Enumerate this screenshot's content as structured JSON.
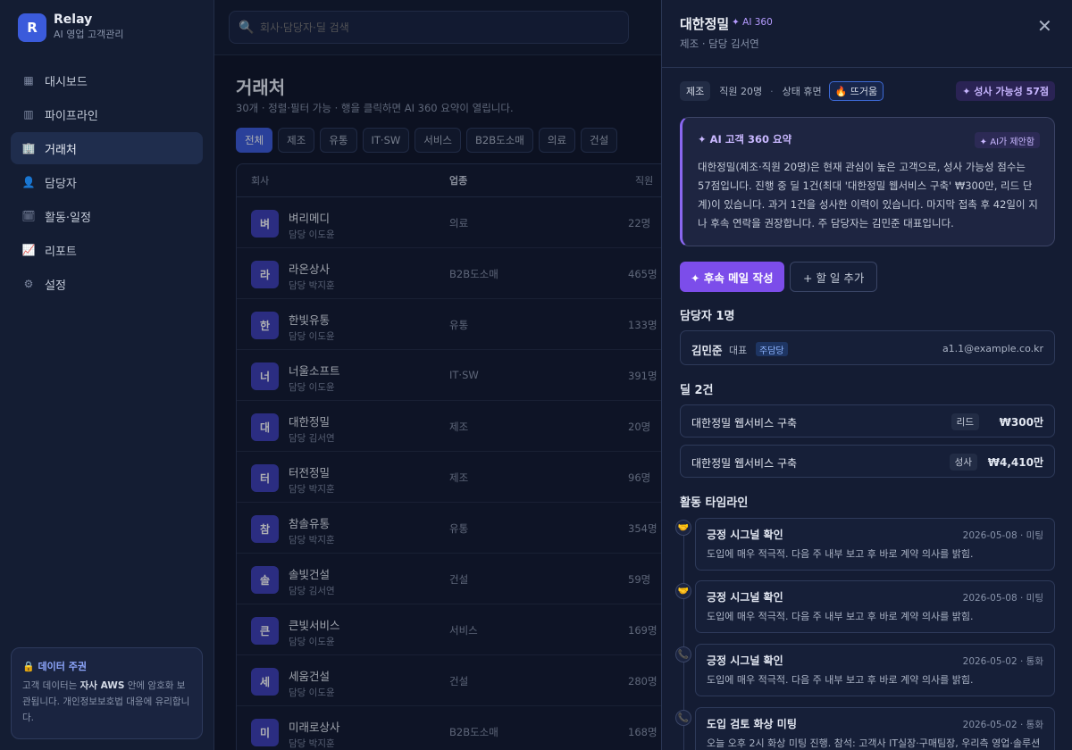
{
  "brand": {
    "logo": "R",
    "name": "Relay",
    "subtitle": "AI 영업 고객관리"
  },
  "nav": [
    {
      "label": "대시보드",
      "icon": "dashboard-icon",
      "glyph": "▦"
    },
    {
      "label": "파이프라인",
      "icon": "pipeline-icon",
      "glyph": "▥"
    },
    {
      "label": "거래처",
      "icon": "building-icon",
      "glyph": "🏢",
      "active": true
    },
    {
      "label": "담당자",
      "icon": "person-icon",
      "glyph": "👤"
    },
    {
      "label": "활동·일정",
      "icon": "calendar-icon",
      "glyph": "🗓"
    },
    {
      "label": "리포트",
      "icon": "chart-icon",
      "glyph": "📈"
    },
    {
      "label": "설정",
      "icon": "gear-icon",
      "glyph": "⚙"
    }
  ],
  "sovereign": {
    "title": "🔒 데이터 주권",
    "body_pre": "고객 데이터는 ",
    "body_bold": "자사 AWS",
    "body_post": " 안에 암호화 보관됩니다. 개인정보보호법 대응에 유리합니다."
  },
  "search": {
    "placeholder": "회사·담당자·딜 검색"
  },
  "page": {
    "title": "거래처",
    "subtitle": "30개 · 정렬·필터 가능 · 행을 클릭하면 AI 360 요약이 열립니다."
  },
  "chips": [
    {
      "label": "전체",
      "active": true
    },
    {
      "label": "제조"
    },
    {
      "label": "유통"
    },
    {
      "label": "IT·SW"
    },
    {
      "label": "서비스"
    },
    {
      "label": "B2B도소매"
    },
    {
      "label": "의료"
    },
    {
      "label": "건설"
    }
  ],
  "table": {
    "headers": {
      "company": "회사",
      "industry": "업종",
      "staff": "직원"
    },
    "rows": [
      {
        "initial": "벼",
        "name": "벼리메디",
        "owner": "담당 이도윤",
        "industry": "의료",
        "staff": "22명"
      },
      {
        "initial": "라",
        "name": "라온상사",
        "owner": "담당 박지훈",
        "industry": "B2B도소매",
        "staff": "465명"
      },
      {
        "initial": "한",
        "name": "한빛유통",
        "owner": "담당 이도윤",
        "industry": "유통",
        "staff": "133명"
      },
      {
        "initial": "너",
        "name": "너울소프트",
        "owner": "담당 이도윤",
        "industry": "IT·SW",
        "staff": "391명"
      },
      {
        "initial": "대",
        "name": "대한정밀",
        "owner": "담당 김서연",
        "industry": "제조",
        "staff": "20명"
      },
      {
        "initial": "터",
        "name": "터전정밀",
        "owner": "담당 박지훈",
        "industry": "제조",
        "staff": "96명"
      },
      {
        "initial": "참",
        "name": "참솔유통",
        "owner": "담당 박지훈",
        "industry": "유통",
        "staff": "354명"
      },
      {
        "initial": "솔",
        "name": "솔빛건설",
        "owner": "담당 김서연",
        "industry": "건설",
        "staff": "59명"
      },
      {
        "initial": "큰",
        "name": "큰빛서비스",
        "owner": "담당 이도윤",
        "industry": "서비스",
        "staff": "169명"
      },
      {
        "initial": "세",
        "name": "세움건설",
        "owner": "담당 이도윤",
        "industry": "건설",
        "staff": "280명"
      },
      {
        "initial": "미",
        "name": "미래로상사",
        "owner": "담당 박지훈",
        "industry": "B2B도소매",
        "staff": "168명"
      }
    ]
  },
  "drawer": {
    "title": "대한정밀",
    "badge": "✦ AI 360",
    "subtitle": "제조 · 담당 김서연",
    "close": "✕",
    "industry_tag": "제조",
    "staff": "직원 20명",
    "sep": "·",
    "status": "상태 휴면",
    "hot": "🔥 뜨거움",
    "probability": "✦ 성사 가능성 57점",
    "ai": {
      "title": "✦ AI 고객 360 요약",
      "suggest": "✦ AI가 제안함",
      "body": "대한정밀(제조·직원 20명)은 현재 관심이 높은 고객으로, 성사 가능성 점수는 57점입니다. 진행 중 딜 1건(최대 '대한정밀 웹서비스 구축' ₩300만, 리드 단계)이 있습니다. 과거 1건을 성사한 이력이 있습니다. 마지막 접촉 후 42일이 지나 후속 연락을 권장합니다. 주 담당자는 김민준 대표입니다."
    },
    "primary_btn": "✦ 후속 메일 작성",
    "secondary_btn": "+ 할 일 추가",
    "contacts_title": "담당자 1명",
    "contact": {
      "name": "김민준",
      "role": "대표",
      "badge": "주담당",
      "email": "a1.1@example.co.kr"
    },
    "deals_title": "딜 2건",
    "deals": [
      {
        "name": "대한정밀 웹서비스 구축",
        "stage": "리드",
        "amount": "₩300만"
      },
      {
        "name": "대한정밀 웹서비스 구축",
        "stage": "성사",
        "amount": "₩4,410만"
      }
    ],
    "timeline_title": "활동 타임라인",
    "timeline": [
      {
        "icon": "handshake-icon",
        "glyph": "🤝",
        "title": "긍정 시그널 확인",
        "meta": "2026-05-08 · 미팅",
        "body": "도입에 매우 적극적. 다음 주 내부 보고 후 바로 계약 의사를 밝힘."
      },
      {
        "icon": "handshake-icon",
        "glyph": "🤝",
        "title": "긍정 시그널 확인",
        "meta": "2026-05-08 · 미팅",
        "body": "도입에 매우 적극적. 다음 주 내부 보고 후 바로 계약 의사를 밝힘."
      },
      {
        "icon": "phone-icon",
        "glyph": "📞",
        "title": "긍정 시그널 확인",
        "meta": "2026-05-02 · 통화",
        "body": "도입에 매우 적극적. 다음 주 내부 보고 후 바로 계약 의사를 밝힘."
      },
      {
        "icon": "phone-icon",
        "glyph": "📞",
        "title": "도입 검토 화상 미팅",
        "meta": "2026-05-02 · 통화",
        "body": "오늘 오후 2시 화상 미팅 진행. 참석: 고객사 IT실장·구매팀장, 우리측 영업·솔루션"
      }
    ]
  }
}
